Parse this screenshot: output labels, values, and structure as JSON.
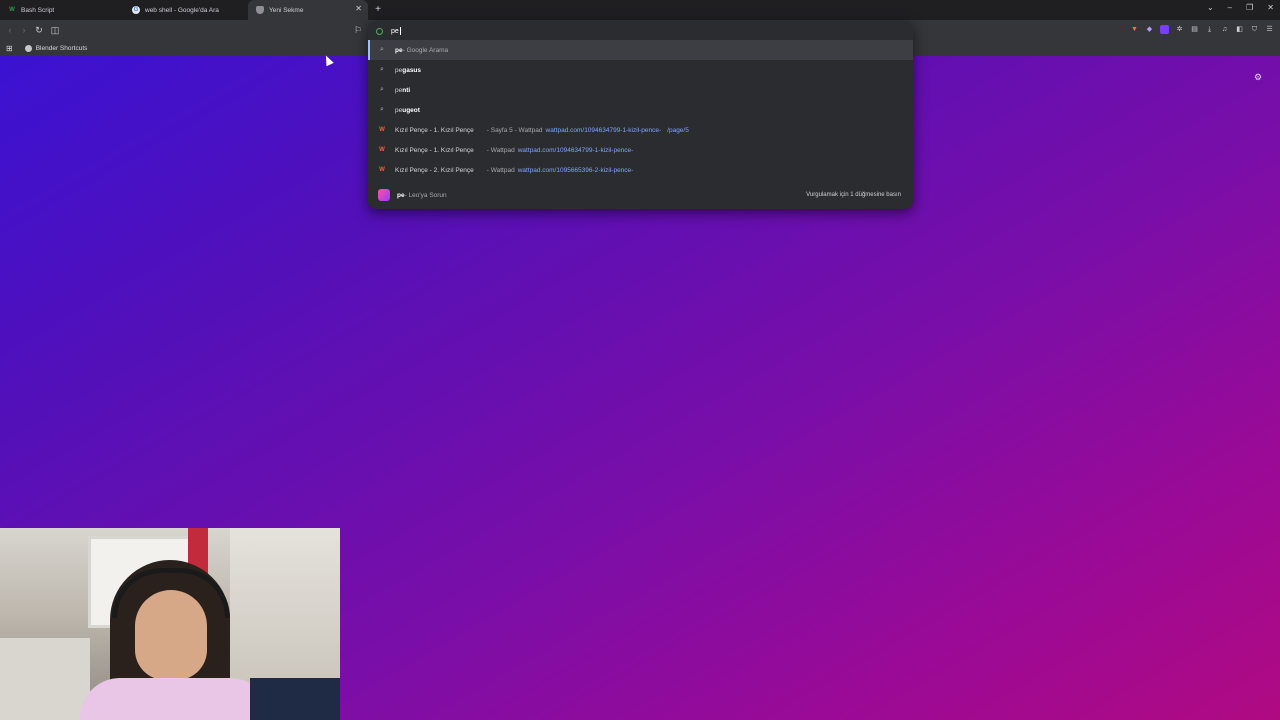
{
  "tabs": [
    {
      "title": "Bash Script",
      "favicon_color": "#2a9d4a",
      "favicon_glyph": "W"
    },
    {
      "title": "web shell - Google'da Ara",
      "favicon_color": "#e8e8e8",
      "favicon_glyph": "G"
    },
    {
      "title": "Yeni Sekme",
      "favicon_color": "#8f8f95",
      "favicon_glyph": ""
    }
  ],
  "bookmarks": [
    {
      "label": "Blender Shortcuts"
    }
  ],
  "omnibox": {
    "query": "pe",
    "suggestions": [
      {
        "type": "search",
        "bold": "pe",
        "rest": " - Google Arama"
      },
      {
        "type": "search",
        "bold": "pe",
        "rest": "gasus"
      },
      {
        "type": "search",
        "bold": "pe",
        "rest": "nti"
      },
      {
        "type": "search",
        "bold": "pe",
        "rest": "ugeot"
      }
    ],
    "history": [
      {
        "title": "Kızıl Pençe - 1. Kızıl Pençe",
        "extra": " - Sayfa 5 - Wattpad",
        "url": "wattpad.com/1094634799-1-kizil-pence-",
        "url_tail": " /page/5"
      },
      {
        "title": "Kızıl Pençe - 1. Kızıl Pençe",
        "extra": " - Wattpad",
        "url": "wattpad.com/1094634799-1-kizil-pence-",
        "url_tail": ""
      },
      {
        "title": "Kızıl Pençe - 2. Kızıl Pençe",
        "extra": " - Wattpad",
        "url": "wattpad.com/1095665396-2-kizil-pence-",
        "url_tail": ""
      }
    ],
    "leo": {
      "bold": "pe",
      "rest": " - Leo'ya Sorun",
      "hint": "Vurgulamak için 1 düğmesine basın"
    }
  },
  "colors": {
    "accent": "#a9b9ff",
    "url": "#7ea6ff",
    "wattpad": "#ff5a3a"
  }
}
